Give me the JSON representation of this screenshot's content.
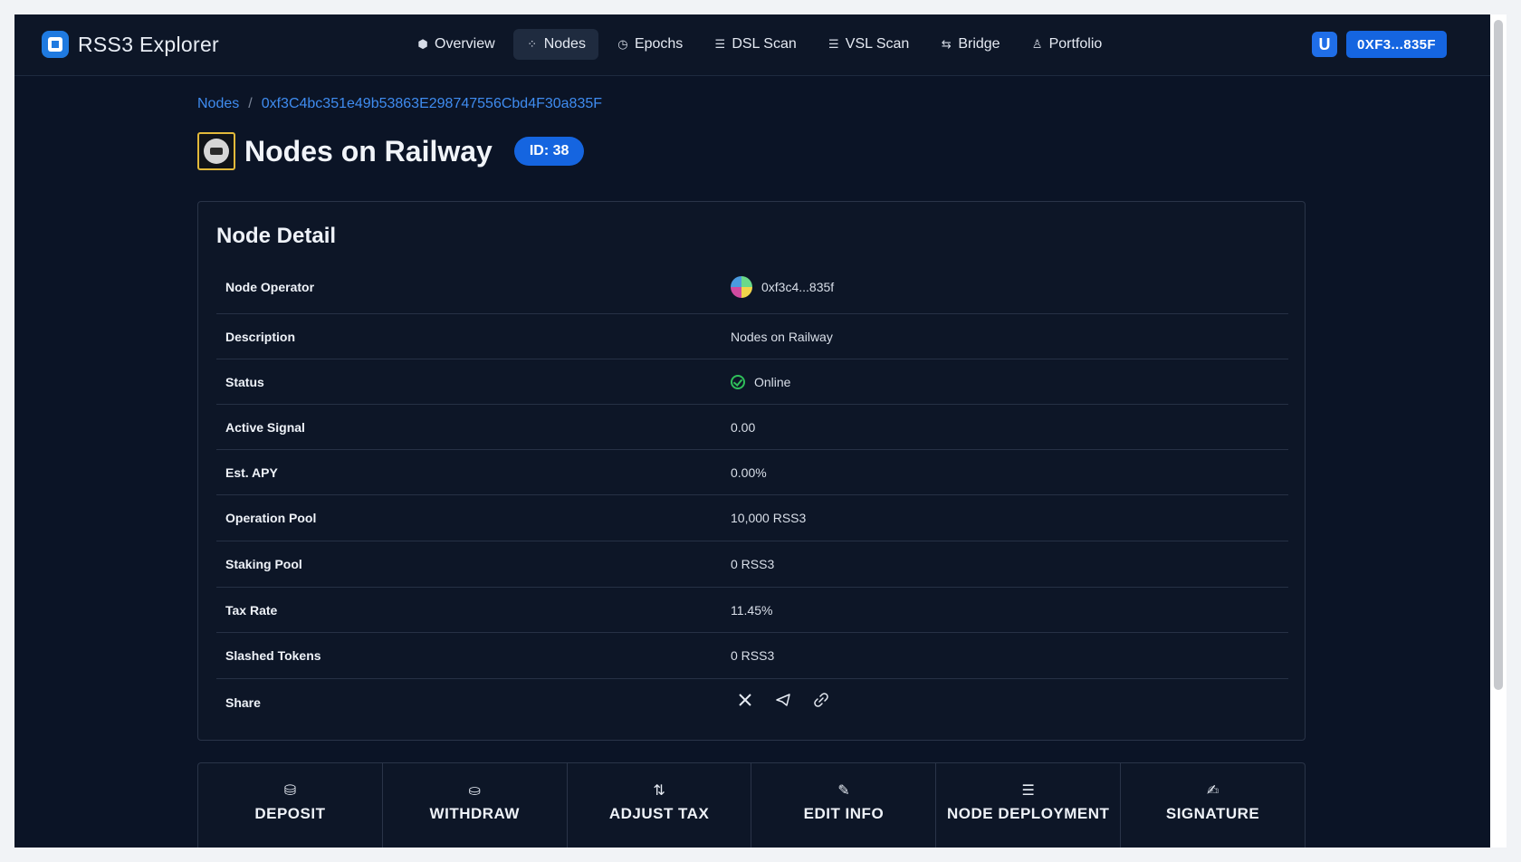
{
  "header": {
    "brand": "RSS3 Explorer",
    "nav": [
      {
        "label": "Overview",
        "icon": "cube-icon",
        "glyph": "⬢",
        "active": false
      },
      {
        "label": "Nodes",
        "icon": "network-icon",
        "glyph": "⁘",
        "active": true
      },
      {
        "label": "Epochs",
        "icon": "clock-icon",
        "glyph": "◷",
        "active": false
      },
      {
        "label": "DSL Scan",
        "icon": "scan-icon",
        "glyph": "☰",
        "active": false
      },
      {
        "label": "VSL Scan",
        "icon": "scan-icon",
        "glyph": "☰",
        "active": false
      },
      {
        "label": "Bridge",
        "icon": "bridge-icon",
        "glyph": "⇆",
        "active": false
      },
      {
        "label": "Portfolio",
        "icon": "user-icon",
        "glyph": "♙",
        "active": false
      }
    ],
    "wallet_glyph": "U",
    "address": "0XF3...835F"
  },
  "breadcrumb": {
    "root": "Nodes",
    "separator": "/",
    "current": "0xf3C4bc351e49b53863E298747556Cbd4F30a835F"
  },
  "page": {
    "title": "Nodes on Railway",
    "id_badge": "ID: 38"
  },
  "detail": {
    "title": "Node Detail",
    "rows": {
      "operator": {
        "label": "Node Operator",
        "value": "0xf3c4...835f"
      },
      "description": {
        "label": "Description",
        "value": "Nodes on Railway"
      },
      "status": {
        "label": "Status",
        "value": "Online",
        "color": "#2fbf5a"
      },
      "active_signal": {
        "label": "Active Signal",
        "value": "0.00"
      },
      "apy": {
        "label": "Est. APY",
        "value": "0.00%"
      },
      "operation_pool": {
        "label": "Operation Pool",
        "value": "10,000 RSS3"
      },
      "staking_pool": {
        "label": "Staking Pool",
        "value": "0 RSS3"
      },
      "tax_rate": {
        "label": "Tax Rate",
        "value": "11.45%"
      },
      "slashed": {
        "label": "Slashed Tokens",
        "value": "0 RSS3"
      },
      "share": {
        "label": "Share",
        "icons": [
          "x-icon",
          "telegram-icon",
          "link-icon"
        ]
      }
    }
  },
  "actions": [
    {
      "label": "DEPOSIT",
      "icon": "database-icon",
      "glyph": "⛁"
    },
    {
      "label": "WITHDRAW",
      "icon": "coin-icon",
      "glyph": "⛀"
    },
    {
      "label": "ADJUST TAX",
      "icon": "sort-icon",
      "glyph": "⇅"
    },
    {
      "label": "EDIT INFO",
      "icon": "edit-icon",
      "glyph": "✎"
    },
    {
      "label": "NODE DEPLOYMENT",
      "icon": "sliders-icon",
      "glyph": "☰"
    },
    {
      "label": "SIGNATURE",
      "icon": "pen-icon",
      "glyph": "✍"
    }
  ],
  "colors": {
    "accent": "#1565e0",
    "link": "#3f8cf0",
    "background": "#0b1426"
  }
}
